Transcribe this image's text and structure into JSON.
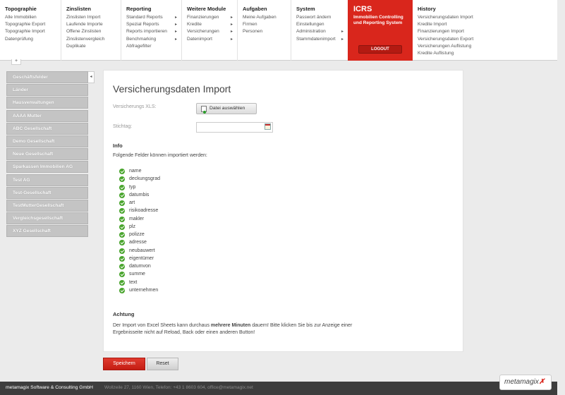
{
  "nav": {
    "topographie": {
      "title": "Topographie",
      "items": [
        "Alle Immobilien",
        "Topographie Export",
        "Topographie Import",
        "Datenprüfung"
      ]
    },
    "zinslisten": {
      "title": "Zinslisten",
      "items": [
        "Zinslisten Import",
        "Laufende Importe",
        "Offene Zinslisten",
        "Zinslistenvergleich",
        "Duplikate"
      ]
    },
    "reporting": {
      "title": "Reporting",
      "items": [
        "Standard Reports",
        "Spezial Reports",
        "Reports importieren",
        "Benchmarking",
        "Abfragefilter"
      ]
    },
    "weitere": {
      "title": "Weitere Module",
      "items": [
        "Finanzierungen",
        "Kredite",
        "Versicherungen",
        "Datenimport"
      ]
    },
    "aufgaben": {
      "title": "Aufgaben",
      "items": [
        "Meine Aufgaben",
        "Firmen",
        "Personen"
      ]
    },
    "system": {
      "title": "System",
      "items": [
        "Passwort ändern",
        "Einstellungen",
        "Administration",
        "Stammdatenimport"
      ]
    },
    "icrs": {
      "title": "ICRS",
      "subtitle_1": "Immobilien Controlling",
      "subtitle_2": "und Reporting System",
      "logout": "LOGOUT"
    },
    "history": {
      "title": "History",
      "items": [
        "Versicherungsdaten Import",
        "Kredite Import",
        "Finanzierungen Import",
        "Versicherungsdaten Export",
        "Versicherungen Auflistung",
        "Kredite Auflistung"
      ]
    }
  },
  "sidebar": {
    "items": [
      "Geschäftsfelder",
      "Länder",
      "Hausverwaltungen",
      "AAAA Mutter",
      "ABC Gesellschaft",
      "Demo Gesellschaft",
      "Neue Gesellschaft",
      "Sparkassen Immobilien AG",
      "Test AG",
      "Test-Gesellschaft",
      "TestMutterGesellschaft",
      "Vergleichsgesellschaft",
      "XYZ Gesellschaft"
    ]
  },
  "main": {
    "title": "Versicherungsdaten Import",
    "xls_label": "Versicherungs XLS:",
    "file_button": "Datei auswählen",
    "stichtag_label": "Stichtag:",
    "stichtag_value": "",
    "info_title": "Info",
    "info_text": "Folgende Felder können importiert werden:",
    "fields": [
      "name",
      "deckungsgrad",
      "typ",
      "datumbis",
      "art",
      "risikoadresse",
      "makler",
      "plz",
      "polizze",
      "adresse",
      "neubauwert",
      "eigentümer",
      "datumvon",
      "summe",
      "text",
      "unternehmen"
    ],
    "warning_title": "Achtung",
    "warning_pre": "Der Import von Excel Sheets kann durchaus ",
    "warning_bold": "mehrere Minuten",
    "warning_post": " dauern! Bitte klicken Sie bis zur Anzeige einer Ergebnisseite nicht auf Reload, Back oder einen anderen Button!"
  },
  "buttons": {
    "save": "Speichern",
    "reset": "Reset"
  },
  "footer": {
    "company": "metamagix Software & Consulting GmbH",
    "address": "Wollzeile 27, 1160 Wien, Telefon: +43 1 8603 604, office@metamagix.net",
    "logo": "metamagix"
  }
}
